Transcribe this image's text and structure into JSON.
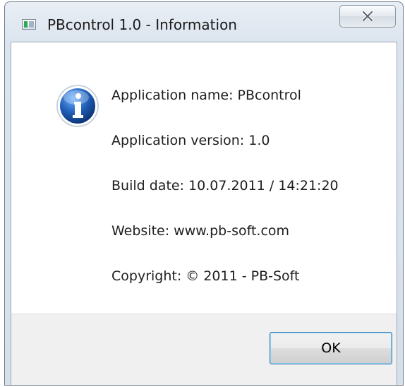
{
  "window": {
    "title": "PBcontrol 1.0 - Information"
  },
  "icons": {
    "app": "app-icon",
    "info": "info-icon",
    "close": "close-icon"
  },
  "info": {
    "lines": [
      "Application name: PBcontrol",
      "Application version: 1.0",
      "Build date: 10.07.2011 / 14:21:20",
      "Website: www.pb-soft.com",
      "Copyright: © 2011 - PB-Soft"
    ]
  },
  "buttons": {
    "ok_label": "OK"
  },
  "colors": {
    "info_icon_blue": "#1f5fb8",
    "focus_border": "#3c7fb1"
  }
}
